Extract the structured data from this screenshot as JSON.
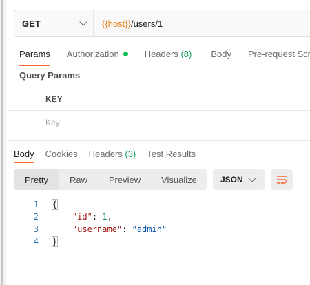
{
  "request": {
    "method": "GET",
    "url_var": "{{host}}",
    "url_path": "/users/1"
  },
  "request_tabs": [
    {
      "label": "Params",
      "active": true
    },
    {
      "label": "Authorization",
      "indicator": "green-dot"
    },
    {
      "label": "Headers",
      "count": "(8)"
    },
    {
      "label": "Body"
    },
    {
      "label": "Pre-request Scrip"
    }
  ],
  "params": {
    "section_label": "Query Params",
    "header_key": "KEY",
    "key_placeholder": "Key"
  },
  "response_tabs": [
    {
      "label": "Body",
      "active": true
    },
    {
      "label": "Cookies"
    },
    {
      "label": "Headers",
      "count": "(3)"
    },
    {
      "label": "Test Results"
    }
  ],
  "format": {
    "options": [
      "Pretty",
      "Raw",
      "Preview",
      "Visualize"
    ],
    "active": "Pretty",
    "language": "JSON",
    "wrap_icon": "wrap-lines-icon"
  },
  "code": {
    "lines": [
      {
        "n": "1",
        "text": "{"
      },
      {
        "n": "2",
        "text": "    \"id\": 1,"
      },
      {
        "n": "3",
        "text": "    \"username\": \"admin\""
      },
      {
        "n": "4",
        "text": "}"
      }
    ]
  },
  "colors": {
    "accent": "#ff6c37",
    "variable": "#e5821d",
    "count": "#0e9e5c",
    "status_dot": "#0cbb52",
    "line_number": "#2f76b0"
  }
}
